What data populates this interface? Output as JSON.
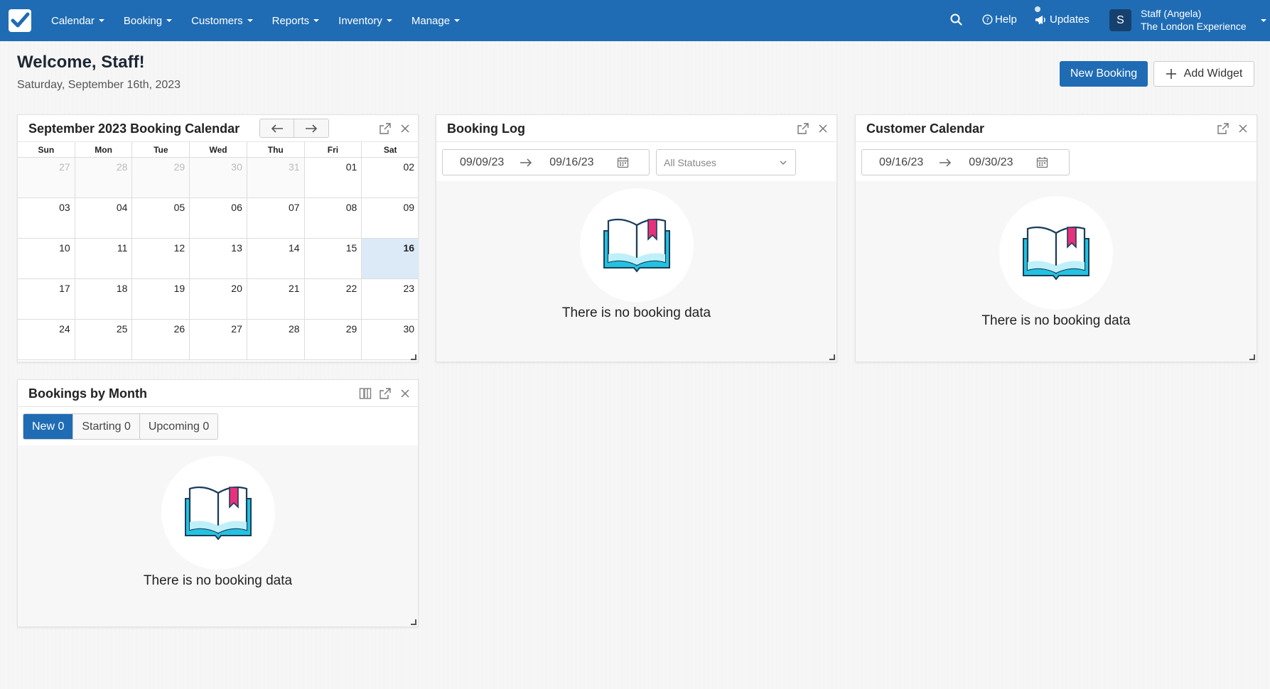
{
  "nav": {
    "items": [
      {
        "label": "Calendar"
      },
      {
        "label": "Booking"
      },
      {
        "label": "Customers"
      },
      {
        "label": "Reports"
      },
      {
        "label": "Inventory"
      },
      {
        "label": "Manage"
      }
    ],
    "help_label": "Help",
    "updates_label": "Updates",
    "avatar_letter": "S",
    "user_name": "Staff (Angela)",
    "company": "The London Experience"
  },
  "header": {
    "welcome": "Welcome, Staff!",
    "date": "Saturday, September 16th, 2023",
    "new_booking": "New Booking",
    "add_widget": "Add Widget"
  },
  "calendar_widget": {
    "title": "September 2023 Booking Calendar",
    "days_of_week": [
      "Sun",
      "Mon",
      "Tue",
      "Wed",
      "Thu",
      "Fri",
      "Sat"
    ],
    "weeks": [
      [
        "27",
        "28",
        "29",
        "30",
        "31",
        "01",
        "02"
      ],
      [
        "03",
        "04",
        "05",
        "06",
        "07",
        "08",
        "09"
      ],
      [
        "10",
        "11",
        "12",
        "13",
        "14",
        "15",
        "16"
      ],
      [
        "17",
        "18",
        "19",
        "20",
        "21",
        "22",
        "23"
      ],
      [
        "24",
        "25",
        "26",
        "27",
        "28",
        "29",
        "30"
      ]
    ],
    "today": "16"
  },
  "booking_log": {
    "title": "Booking Log",
    "from": "09/09/23",
    "to": "09/16/23",
    "status_placeholder": "All Statuses",
    "empty": "There is no booking data"
  },
  "customer_calendar": {
    "title": "Customer Calendar",
    "from": "09/16/23",
    "to": "09/30/23",
    "empty": "There is no booking data"
  },
  "bookings_by_month": {
    "title": "Bookings by Month",
    "tabs": [
      {
        "label": "New 0",
        "active": true
      },
      {
        "label": "Starting 0",
        "active": false
      },
      {
        "label": "Upcoming 0",
        "active": false
      }
    ],
    "empty": "There is no booking data"
  },
  "colors": {
    "brand": "#1f6cb4",
    "today_highlight": "#dceaf8",
    "book_teal": "#23c3e0",
    "bookmark_pink": "#e8317a"
  }
}
